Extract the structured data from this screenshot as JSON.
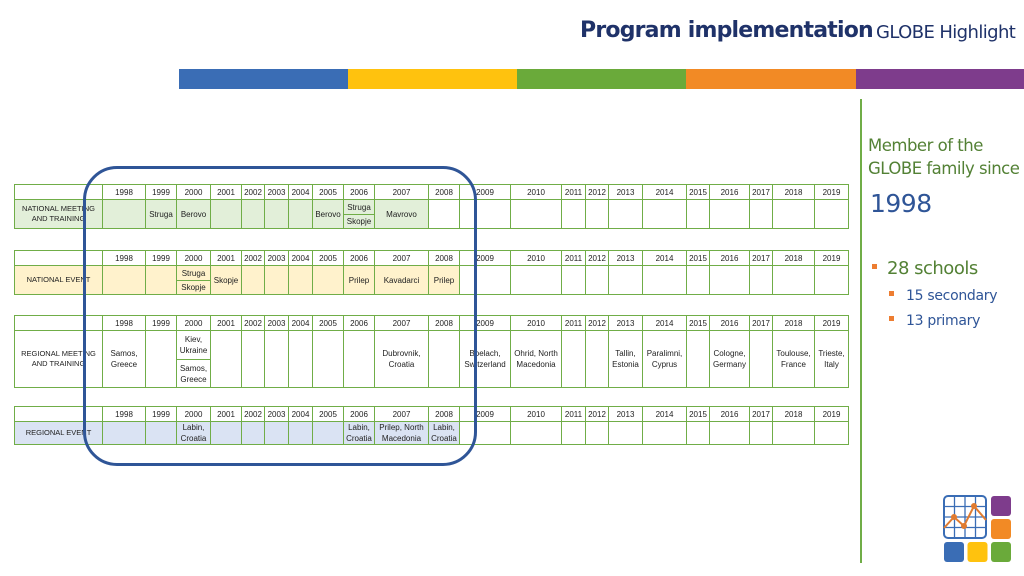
{
  "header": {
    "title": "Program implementation",
    "subtitle": "GLOBE Highlight"
  },
  "colorbar": [
    "#3a6db5",
    "#ffc20e",
    "#6aaa3a",
    "#f28a25",
    "#7e3c8c"
  ],
  "years": [
    "1998",
    "1999",
    "2000",
    "2001",
    "2002",
    "2003",
    "2004",
    "2005",
    "2006",
    "2007",
    "2008",
    "2009",
    "2010",
    "2011",
    "2012",
    "2013",
    "2014",
    "2015",
    "2016",
    "2017",
    "2018",
    "2019"
  ],
  "tables": {
    "national_meeting": {
      "label": "NATIONAL MEETING AND TRAINING",
      "cells": {
        "1999": "Struga",
        "2000": "Berovo",
        "2005": "Berovo",
        "2006_a": "Struga",
        "2006_b": "Skopje",
        "2007": "Mavrovo"
      }
    },
    "national_event": {
      "label": "NATIONAL EVENT",
      "cells": {
        "2000_a": "Struga",
        "2000_b": "Skopje",
        "2001": "Skopje",
        "2006": "Prilep",
        "2007": "Kavadarci",
        "2008": "Prilep"
      }
    },
    "regional_meeting": {
      "label": "REGIONAL MEETING AND TRAINING",
      "cells": {
        "1998": "Samos, Greece",
        "2000_a": "Kiev, Ukraine",
        "2000_b": "Samos, Greece",
        "2007": "Dubrovnik, Croatia",
        "2009": "Boelach, Switzerland",
        "2010": "Ohrid, North Macedonia",
        "2013": "Tallin, Estonia",
        "2014": "Paralimni, Cyprus",
        "2016": "Cologne, Germany",
        "2018": "Toulouse, France",
        "2019": "Trieste, Italy"
      }
    },
    "regional_event": {
      "label": "REGIONAL EVENT",
      "cells": {
        "2000": "Labin, Croatia",
        "2006": "Labin, Croatia",
        "2007": "Prilep, North Macedonia",
        "2008": "Labin, Croatia"
      }
    }
  },
  "sidebar": {
    "member_text": "Member of the GLOBE family since",
    "member_year": "1998",
    "schools_total": "28 schools",
    "schools_breakdown": [
      "15 secondary",
      "13 primary"
    ]
  },
  "logo": {
    "icon": "globe-chart-logo-icon",
    "colors": [
      "#7e3c8c",
      "#f28a25",
      "#3a6db5",
      "#ffc20e",
      "#6aaa3a"
    ]
  }
}
